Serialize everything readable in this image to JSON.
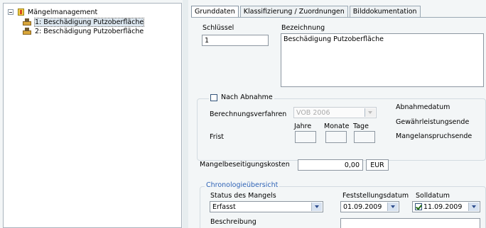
{
  "tree": {
    "root": "Mängelmanagement",
    "items": [
      {
        "label": "1: Beschädigung Putzoberfläche",
        "selected": true
      },
      {
        "label": "2: Beschädigung Putzoberfläche",
        "selected": false
      }
    ]
  },
  "tabs": [
    "Grunddaten",
    "Klassifizierung / Zuordnungen",
    "Bilddokumentation"
  ],
  "form": {
    "schluessel_label": "Schlüssel",
    "schluessel_value": "1",
    "bezeichnung_label": "Bezeichnung",
    "bezeichnung_value": "Beschädigung Putzoberfläche",
    "nach_abnahme_label": "Nach Abnahme",
    "berechnungsverfahren_label": "Berechnungsverfahren",
    "berechnungsverfahren_value": "VOB 2006",
    "jahre_label": "Jahre",
    "monate_label": "Monate",
    "tage_label": "Tage",
    "frist_label": "Frist",
    "abnahmedatum_label": "Abnahmedatum",
    "gewaehrleistungsende_label": "Gewährleistungsende",
    "mangelanspruchsende_label": "Mangelanspruchsende",
    "kosten_label": "Mangelbeseitigungskosten",
    "kosten_value": "0,00",
    "currency": "EUR",
    "chronologie_label": "Chronologieübersicht",
    "status_label": "Status des Mangels",
    "status_value": "Erfasst",
    "feststellungsdatum_label": "Feststellungsdatum",
    "feststellungsdatum_value": "01.09.2009",
    "solldatum_label": "Solldatum",
    "solldatum_value": "11.09.2009",
    "beschreibung_label": "Beschreibung"
  },
  "colors": {
    "background": "#f3f6f7",
    "accent": "#2b4b8c",
    "group_label": "#2f63b6"
  }
}
